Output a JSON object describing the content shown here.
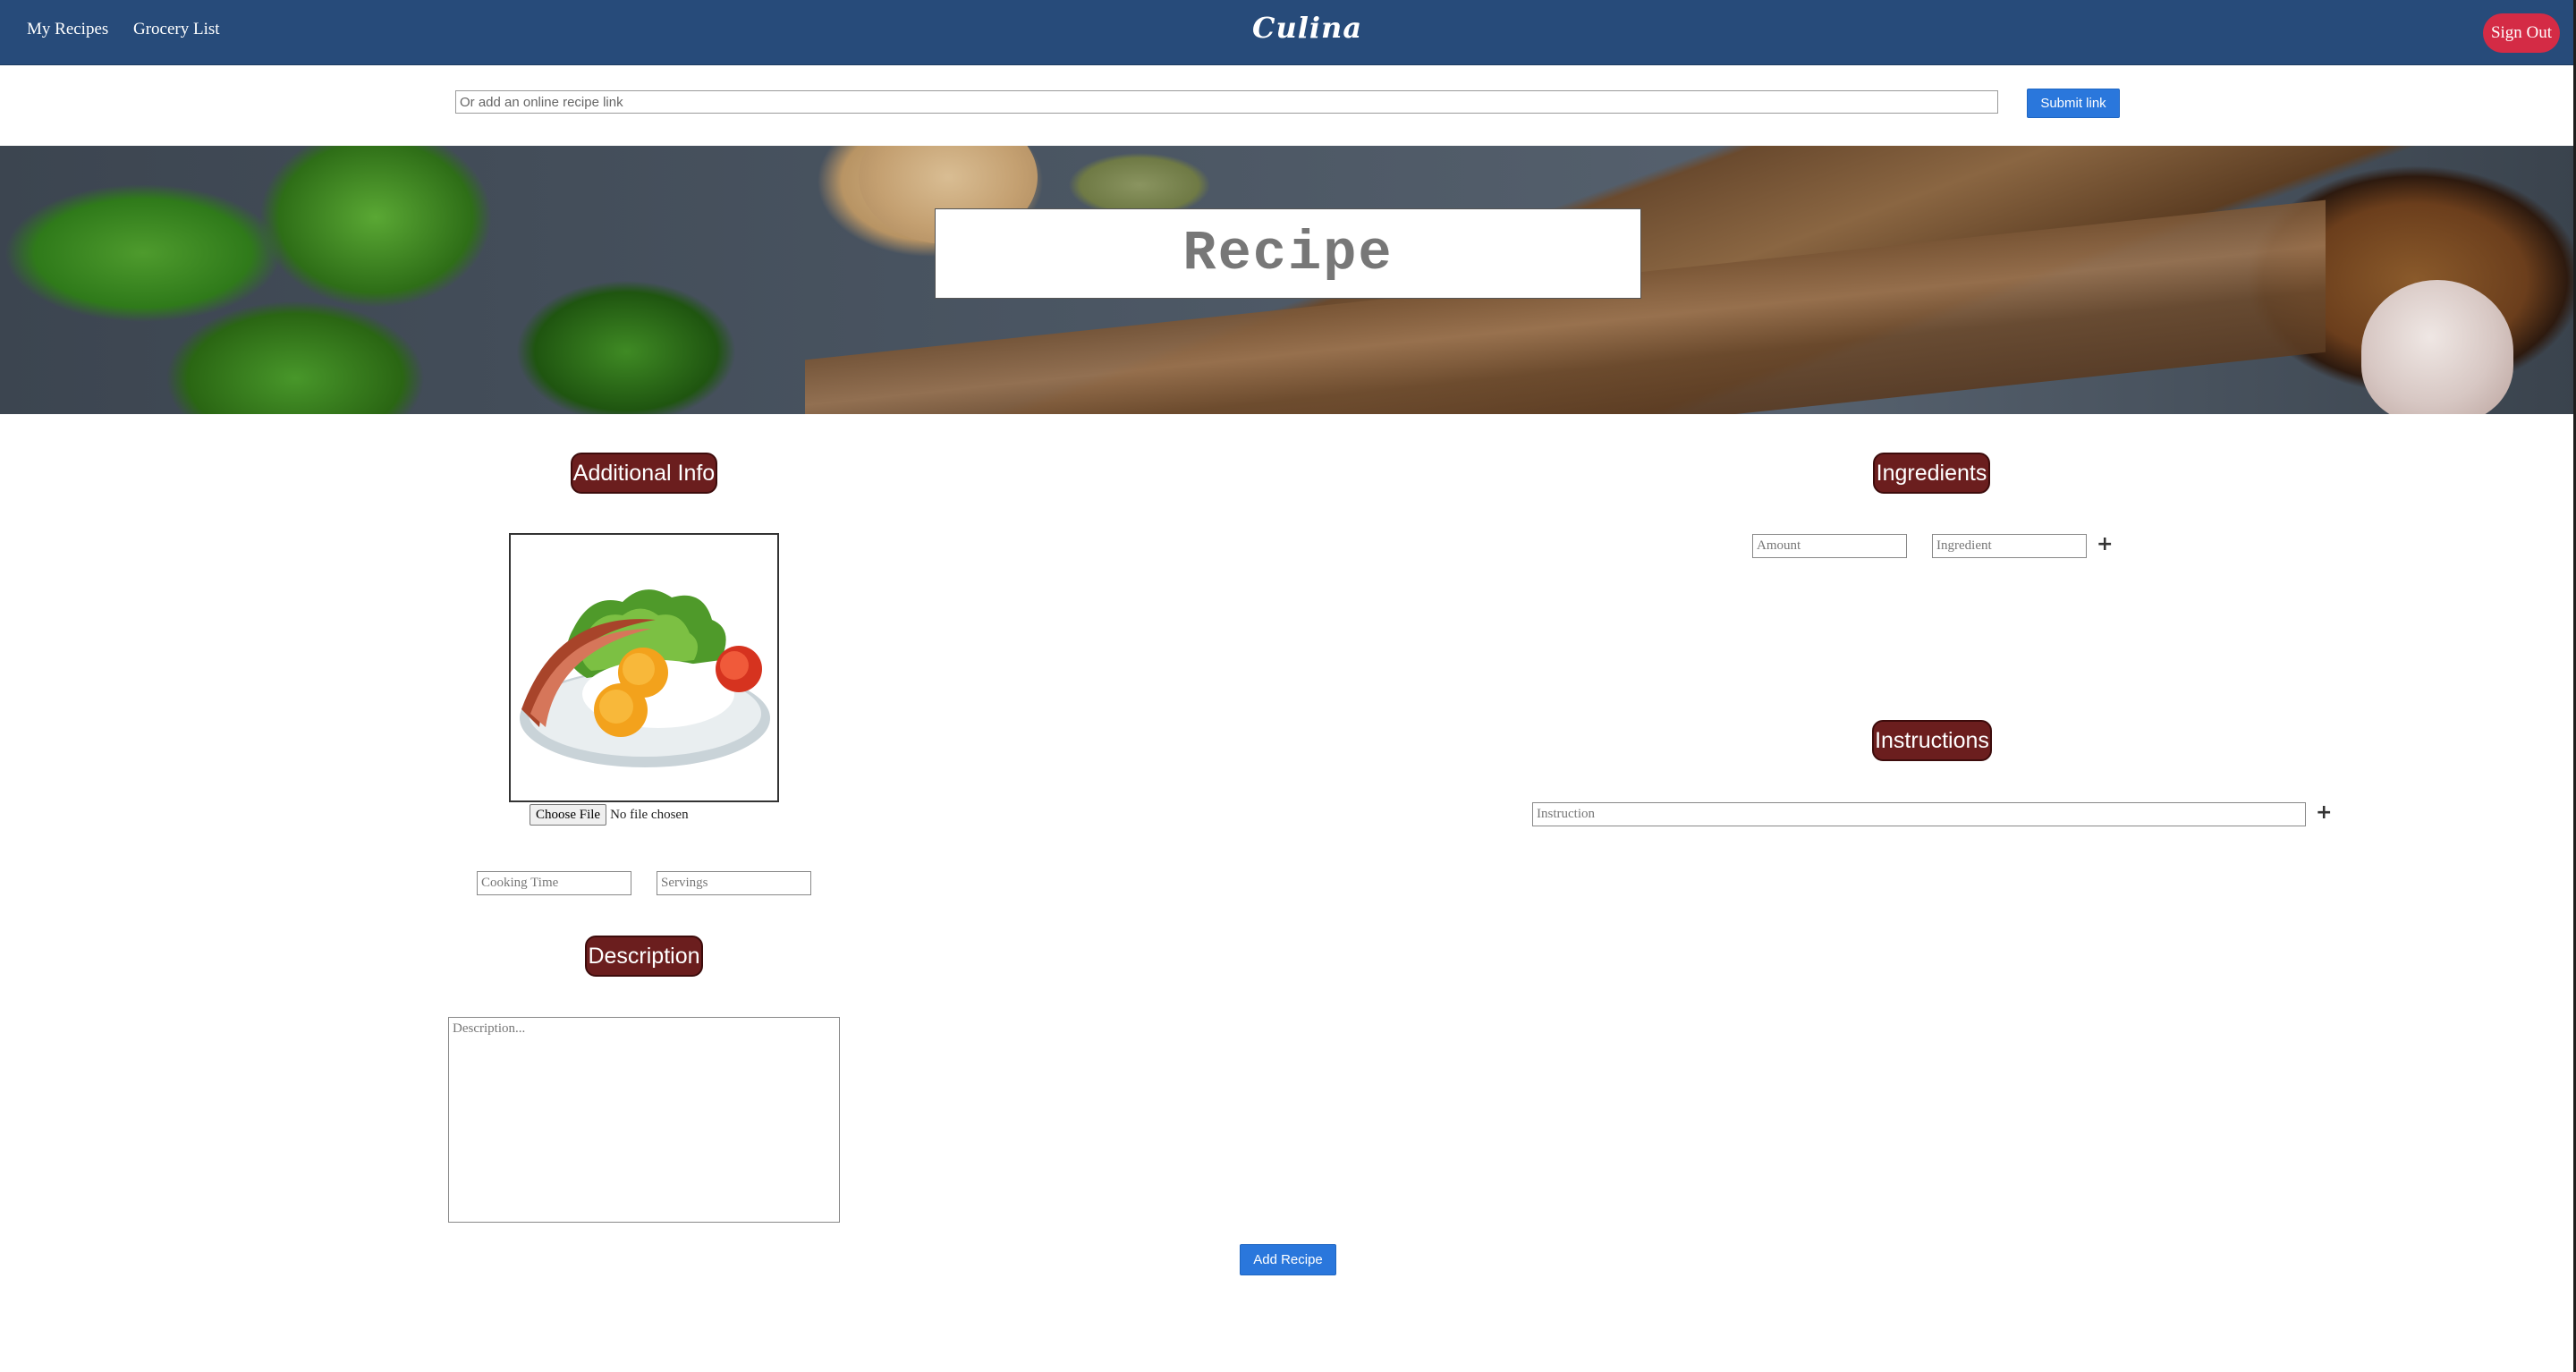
{
  "nav": {
    "my_recipes": "My Recipes",
    "grocery_list": "Grocery List",
    "brand": "Culina",
    "sign_out": "Sign Out"
  },
  "link_bar": {
    "placeholder": "Or add an online recipe link",
    "submit_label": "Submit link"
  },
  "hero": {
    "title_placeholder": "Recipe"
  },
  "additional_info": {
    "heading": "Additional Info",
    "image_alt": "plate of bacon, eggs and salad",
    "choose_file_label": "Choose File",
    "file_status": "No file chosen",
    "cooking_time_placeholder": "Cooking Time",
    "servings_placeholder": "Servings"
  },
  "description": {
    "heading": "Description",
    "placeholder": "Description..."
  },
  "ingredients": {
    "heading": "Ingredients",
    "amount_placeholder": "Amount",
    "ingredient_placeholder": "Ingredient",
    "add_icon": "plus-icon"
  },
  "instructions": {
    "heading": "Instructions",
    "instruction_placeholder": "Instruction",
    "add_icon": "plus-icon"
  },
  "actions": {
    "add_recipe_label": "Add Recipe"
  },
  "colors": {
    "navbar": "#274b7a",
    "sign_out": "#d42b45",
    "primary_button": "#2a77dc",
    "section_pill": "#6b1e1e"
  }
}
